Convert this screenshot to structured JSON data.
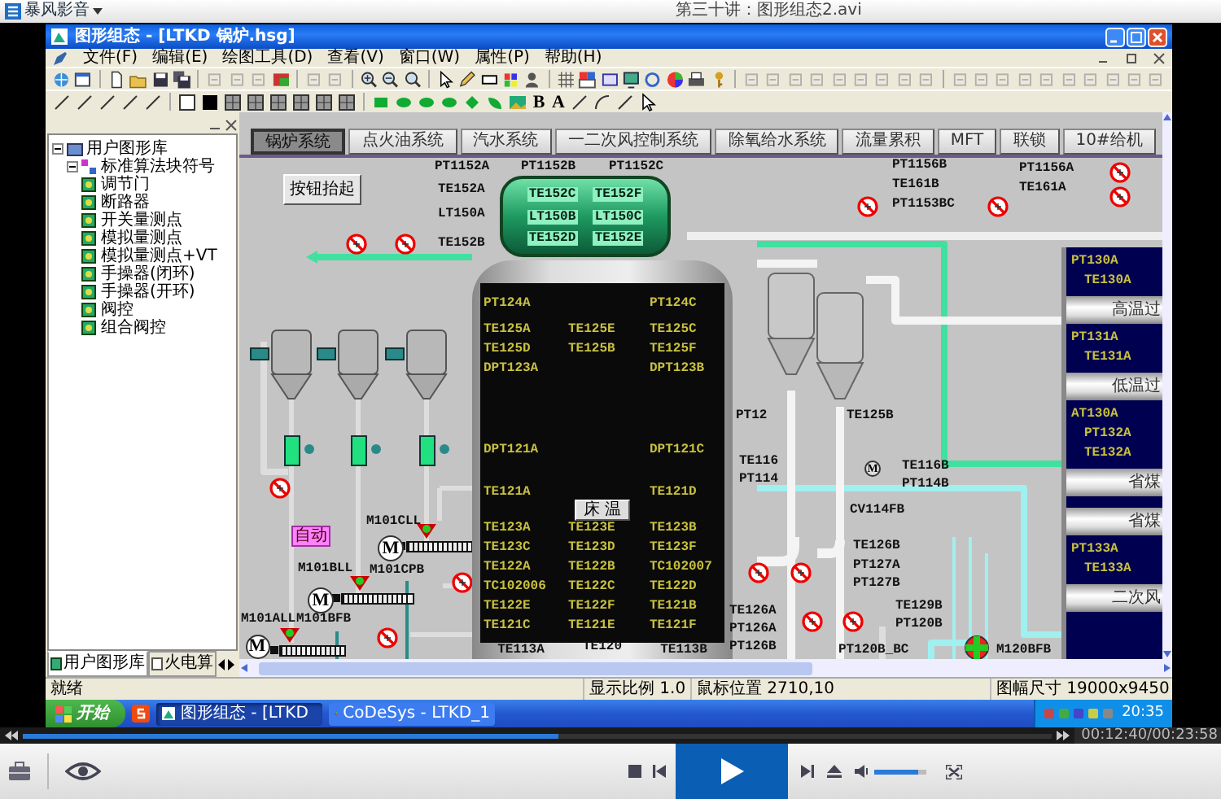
{
  "player": {
    "logo": "暴风影音",
    "title": "第三十讲：图形组态2.avi",
    "time": "00:12:40/00:23:58",
    "progress": {
      "level": 0.52
    },
    "volume": {
      "level": 0.85
    }
  },
  "window": {
    "title": "图形组态 - [LTKD 锅炉.hsg]"
  },
  "menu": [
    "文件(F)",
    "编辑(E)",
    "绘图工具(D)",
    "查看(V)",
    "窗口(W)",
    "属性(P)",
    "帮助(H)"
  ],
  "drawing_toolbar": {
    "text_buttons": [
      "B",
      "A"
    ]
  },
  "library": {
    "tree": [
      {
        "label": "用户图形库",
        "expanded": true,
        "children": [
          {
            "label": "标准算法块符号",
            "expanded": true,
            "children": [
              {
                "label": "调节门"
              },
              {
                "label": "断路器"
              },
              {
                "label": "开关量测点"
              },
              {
                "label": "模拟量测点"
              },
              {
                "label": "模拟量测点+VT"
              },
              {
                "label": "手操器(闭环)"
              },
              {
                "label": "手操器(开环)"
              },
              {
                "label": "阀控"
              },
              {
                "label": "组合阀控"
              }
            ]
          }
        ]
      }
    ],
    "tabs": [
      {
        "label": "用户图形库",
        "selected": true
      },
      {
        "label": "火电算",
        "selected": false
      }
    ]
  },
  "canvas": {
    "tabs": [
      {
        "label": "锅炉系统",
        "selected": true
      },
      {
        "label": "点火油系统",
        "selected": false
      },
      {
        "label": "汽水系统",
        "selected": false
      },
      {
        "label": "一二次风控制系统",
        "selected": false
      },
      {
        "label": "除氧给水系统",
        "selected": false
      },
      {
        "label": "流量累积",
        "selected": false
      },
      {
        "label": "MFT",
        "selected": false
      },
      {
        "label": "联锁",
        "selected": false
      },
      {
        "label": "10#给机",
        "selected": false
      }
    ],
    "button": "按钮抬起",
    "drum": [
      "TE152C",
      "TE152F",
      "LT150B",
      "LT150C",
      "TE152D",
      "TE152E"
    ],
    "tags": [
      "PT1152A",
      "PT1152B",
      "PT1152C",
      "TE152A",
      "LT150A",
      "TE152B",
      "PT1156B",
      "TE161B",
      "PT1153BC",
      "PT1156A",
      "TE161A",
      "PT12",
      "TE125B",
      "TE116",
      "PT114",
      "TE116B",
      "PT114B",
      "CV114FB",
      "M101CLL",
      "TE126B",
      "PT127A",
      "PT127B",
      "M101BLL",
      "M101CPB",
      "TE129B",
      "PT120B",
      "TE126A",
      "PT126A",
      "PT126B",
      "M101ALL",
      "M101BFB",
      "PT120B_BC",
      "M120BFB"
    ],
    "badge": "自动",
    "motors": [
      "M",
      "M",
      "M",
      "M"
    ],
    "furnace": {
      "upper_rows": [
        {
          "left": "PT124A",
          "right": "PT124C"
        },
        {
          "left": "TE125A",
          "center": "TE125E",
          "right": "TE125C"
        },
        {
          "left": "TE125D",
          "center": "TE125B",
          "right": "TE125F"
        },
        {
          "left": "DPT123A",
          "right": "DPT123B"
        },
        {
          "left": "DPT121A",
          "right": "DPT121C"
        },
        {
          "left": "TE121A",
          "right": "TE121D"
        }
      ],
      "button": "床 温",
      "lower_rows": [
        {
          "left": "TE123A",
          "center": "TE123E",
          "right": "TE123B"
        },
        {
          "left": "TE123C",
          "center": "TE123D",
          "right": "TE123F"
        },
        {
          "left": "TE122A",
          "center": "TE122B",
          "right": "TC102007"
        },
        {
          "left": "TC102006",
          "center": "TE122C",
          "right": "TE122D"
        },
        {
          "left": "TE122E",
          "center": "TE122F",
          "right": "TE121B"
        },
        {
          "left": "TE121C",
          "center": "TE121E",
          "right": "TE121F"
        }
      ],
      "bottom_labels": [
        "TE113A",
        "TE120",
        "TE113B"
      ]
    },
    "side_panels": [
      {
        "kind": "readings",
        "lines": [
          "PT130A",
          "TE130A"
        ]
      },
      {
        "kind": "header",
        "label": "高温过"
      },
      {
        "kind": "readings",
        "lines": [
          "PT131A",
          "TE131A"
        ]
      },
      {
        "kind": "header",
        "label": "低温过"
      },
      {
        "kind": "readings",
        "lines": [
          "AT130A",
          "PT132A",
          "TE132A"
        ]
      },
      {
        "kind": "header",
        "label": "省煤"
      },
      {
        "kind": "blank"
      },
      {
        "kind": "header",
        "label": "省煤"
      },
      {
        "kind": "readings",
        "lines": [
          "PT133A",
          "TE133A"
        ]
      },
      {
        "kind": "header",
        "label": "二次风"
      },
      {
        "kind": "blank"
      }
    ]
  },
  "status_bar": [
    "就绪",
    "显示比例 1.0",
    "鼠标位置 2710,10",
    "图幅尺寸 19000x9450"
  ],
  "taskbar": {
    "start": "开始",
    "tasks": [
      {
        "label": "图形组态 - [LTKD",
        "selected": true
      },
      {
        "label": "CoDeSys - LTKD_1",
        "selected": false
      }
    ],
    "clock": "20:35"
  }
}
